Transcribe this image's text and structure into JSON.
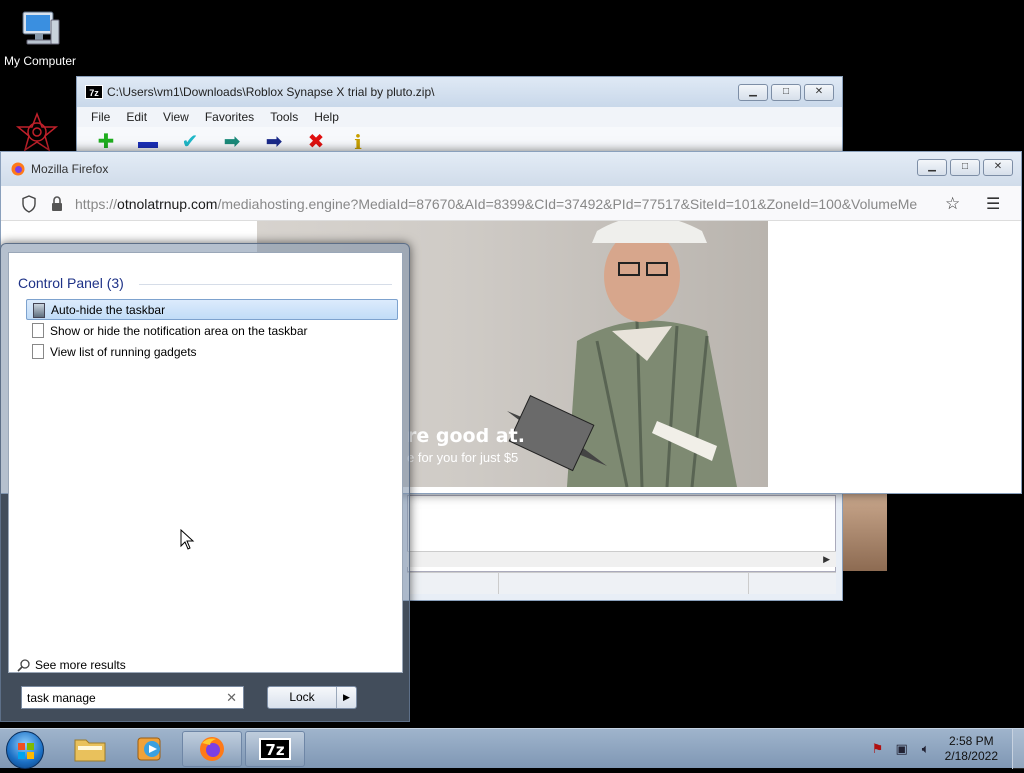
{
  "desktop": {
    "icons": [
      {
        "label": "My Computer",
        "icon": "computer-icon"
      }
    ]
  },
  "zip_window": {
    "title": "C:\\Users\\vm1\\Downloads\\Roblox Synapse X trial by pluto.zip\\",
    "app_icon_text": "7z",
    "menu": [
      "File",
      "Edit",
      "View",
      "Favorites",
      "Tools",
      "Help"
    ],
    "toolbar": [
      {
        "icon": "add-icon",
        "glyph": "✚",
        "color": "#1fae1f"
      },
      {
        "icon": "extract-icon",
        "glyph": "▬",
        "color": "#1a2fb8"
      },
      {
        "icon": "test-icon",
        "glyph": "✔",
        "color": "#1fb8c8"
      },
      {
        "icon": "copy-icon",
        "glyph": "➡",
        "color": "#1a8a7a"
      },
      {
        "icon": "move-icon",
        "glyph": "➡",
        "color": "#1a2a8a"
      },
      {
        "icon": "delete-icon",
        "glyph": "✖",
        "color": "#e01010"
      },
      {
        "icon": "info-icon",
        "glyph": "i",
        "color": "#c8a000"
      }
    ]
  },
  "firefox": {
    "title": "Mozilla Firefox",
    "url_prefix": "https://",
    "url_host": "otnolatrnup.com",
    "url_rest": "/mediahosting.engine?MediaId=87670&AId=8399&CId=37492&PId=77517&SiteId=101&ZoneId=100&VolumeMe",
    "ad": {
      "headline": "re good at.",
      "subline": "e for you for just $5"
    }
  },
  "start_menu": {
    "group_header": "Control Panel (3)",
    "results": [
      {
        "label": "Auto-hide the taskbar",
        "selected": true
      },
      {
        "label": "Show or hide the notification area on the taskbar",
        "selected": false
      },
      {
        "label": "View list of running gadgets",
        "selected": false
      }
    ],
    "see_more": "See more results",
    "search_value": "task manage",
    "lock_button": "Lock"
  },
  "taskbar": {
    "items": [
      {
        "name": "explorer",
        "icon": "folder-icon"
      },
      {
        "name": "media-player",
        "icon": "media-player-icon"
      },
      {
        "name": "firefox",
        "icon": "firefox-icon",
        "active": true
      },
      {
        "name": "7zip",
        "icon": "7zip-icon",
        "label": "7z",
        "active": true
      }
    ],
    "clock_time": "2:58 PM",
    "clock_date": "2/18/2022"
  }
}
